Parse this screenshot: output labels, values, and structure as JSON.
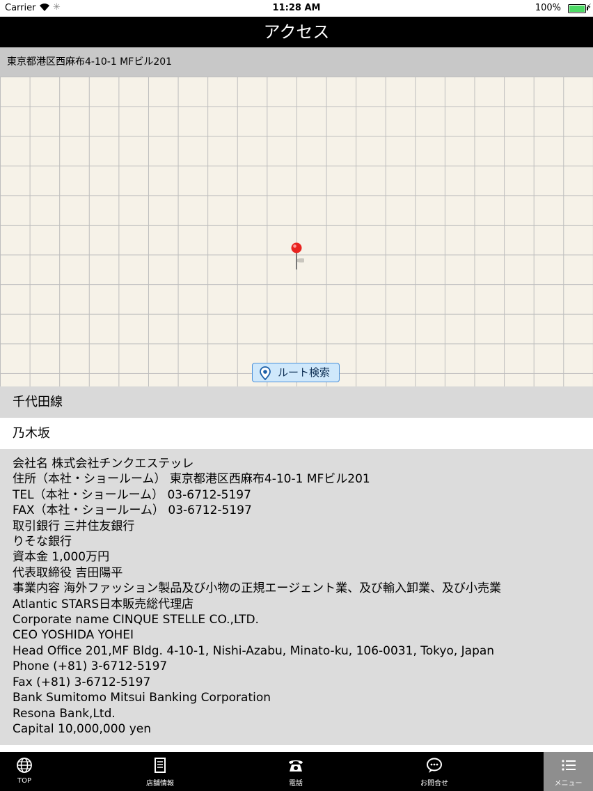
{
  "status": {
    "carrier": "Carrier",
    "time": "11:28 AM",
    "battery": "100%"
  },
  "nav": {
    "title": "アクセス"
  },
  "address": "東京都港区西麻布4-10-1 MFビル201",
  "map": {
    "route_button": "ルート検索"
  },
  "line": "千代田線",
  "station": "乃木坂",
  "company": [
    "会社名 株式会社チンクエステッレ",
    "住所（本社・ショールーム） 東京都港区西麻布4-10-1 MFビル201",
    "TEL（本社・ショールーム） 03-6712-5197",
    "FAX（本社・ショールーム） 03-6712-5197",
    "取引銀行 三井住友銀行",
    "りそな銀行",
    "資本金 1,000万円",
    "代表取締役 吉田陽平",
    "事業内容 海外ファッション製品及び小物の正規エージェント業、及び輸入卸業、及び小売業",
    "Atlantic STARS日本販売総代理店",
    "Corporate name CINQUE STELLE CO.,LTD.",
    "CEO YOSHIDA YOHEI",
    "Head Office 201,MF Bldg. 4-10-1, Nishi-Azabu, Minato-ku, 106-0031, Tokyo, Japan",
    "Phone (+81) 3-6712-5197",
    "Fax (+81) 3-6712-5197",
    "Bank Sumitomo Mitsui Banking Corporation",
    "Resona Bank,Ltd.",
    "Capital 10,000,000 yen"
  ],
  "tabs": [
    {
      "label": "TOP",
      "icon": "globe-icon"
    },
    {
      "label": "店舗情報",
      "icon": "document-icon"
    },
    {
      "label": "電話",
      "icon": "phone-icon"
    },
    {
      "label": "お問合せ",
      "icon": "chat-icon"
    },
    {
      "label": "メニュー",
      "icon": "menu-list-icon"
    }
  ],
  "colors": {
    "nav": "#000000",
    "tab_active": "#8e8e8e",
    "pin": "#e8231f",
    "route_button": "#cfe8fb"
  }
}
